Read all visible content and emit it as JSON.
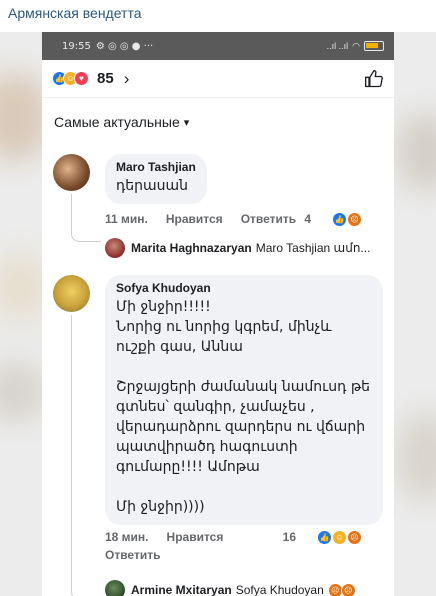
{
  "post": {
    "group_name": "Армянская вендетта"
  },
  "status": {
    "time": "19:55",
    "left_icons": "⚙ ◎ ◎ ● ···",
    "signal": "..ıl ..ıl",
    "wifi": "◠"
  },
  "reactions": {
    "count": "85",
    "chevron": "›"
  },
  "sort": {
    "label": "Самые актуальные",
    "caret": "▾"
  },
  "comments": [
    {
      "author": "Maro Tashjian",
      "text": "դերասան",
      "time": "11 мин.",
      "like": "Нравится",
      "reply": "Ответить",
      "reaction_count": "4",
      "reply_preview": {
        "author": "Marita Haghnazaryan",
        "text": "Maro Tashjian ամո..."
      }
    },
    {
      "author": "Sofya Khudoyan",
      "text": "Մի ջնջիր!!!!!\nՆորից ու նորից կգրեմ, մինչև ուշքի գաս, Աննա\n\nՇրջայցերի ժամանակ նամուսդ թե գտնես՝ զանգիր, չամաչես ,  վերադարձրու զարդերս ու վճարի պատվիրածդ հագուստի գումարը!!!! Ամոթա\n\nՄի ջնջիր))))",
      "time": "18 мин.",
      "like": "Нравится",
      "reply": "Ответить",
      "reaction_count": "16",
      "reply_preview": {
        "author": "Armine Mxitaryan",
        "text": "Sofya Khudoyan"
      }
    }
  ]
}
